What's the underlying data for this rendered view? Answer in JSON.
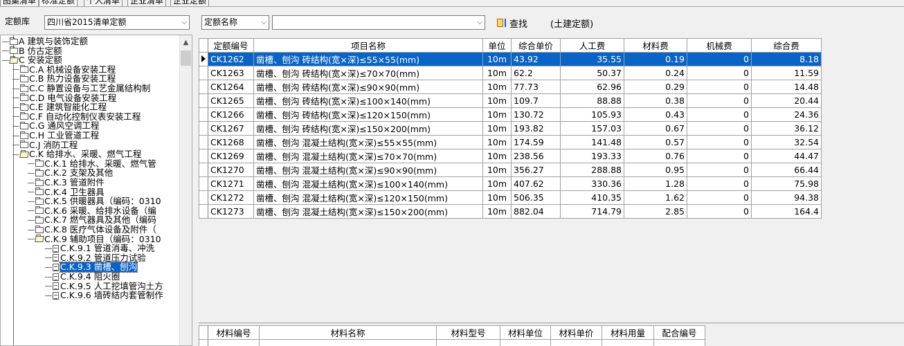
{
  "tabs": [
    "图集清单",
    "标准定额",
    "个人清单",
    "企业清单",
    "企业定额"
  ],
  "toolbar": {
    "library_label": "定额库",
    "library_value": "四川省2015清单定额",
    "field_value": "定额名称",
    "search_value": "",
    "search_label": "查找",
    "search_scope": "(土建定额)"
  },
  "tree": {
    "items": [
      {
        "label": "A 建筑与装饰定额",
        "icon": "folder-closed-icon",
        "depth": 0
      },
      {
        "label": "B 仿古定额",
        "icon": "folder-closed-icon",
        "depth": 0
      },
      {
        "label": "C 安装定额",
        "icon": "folder-open-icon",
        "depth": 0
      },
      {
        "label": "C.A 机械设备安装工程",
        "icon": "folder-closed-icon",
        "depth": 1
      },
      {
        "label": "C.B 热力设备安装工程",
        "icon": "folder-closed-icon",
        "depth": 1
      },
      {
        "label": "C.C 静置设备与工艺金属结构制",
        "icon": "folder-closed-icon",
        "depth": 1
      },
      {
        "label": "C.D 电气设备安装工程",
        "icon": "folder-closed-icon",
        "depth": 1
      },
      {
        "label": "C.E 建筑智能化工程",
        "icon": "folder-closed-icon",
        "depth": 1
      },
      {
        "label": "C.F 自动化控制仪表安装工程",
        "icon": "folder-closed-icon",
        "depth": 1
      },
      {
        "label": "C.G 通风空调工程",
        "icon": "folder-closed-icon",
        "depth": 1
      },
      {
        "label": "C.H 工业管道工程",
        "icon": "folder-closed-icon",
        "depth": 1
      },
      {
        "label": "C.J 消防工程",
        "icon": "folder-closed-icon",
        "depth": 1
      },
      {
        "label": "C.K 给排水、采暖、燃气工程",
        "icon": "folder-open-icon",
        "depth": 1
      },
      {
        "label": "C.K.1 给排水、采暖、燃气管",
        "icon": "folder-closed-icon",
        "depth": 2
      },
      {
        "label": "C.K.2 支架及其他",
        "icon": "folder-closed-icon",
        "depth": 2
      },
      {
        "label": "C.K.3 管道附件",
        "icon": "folder-closed-icon",
        "depth": 2
      },
      {
        "label": "C.K.4 卫生器具",
        "icon": "folder-closed-icon",
        "depth": 2
      },
      {
        "label": "C.K.5 供暖器具（编码：0310",
        "icon": "folder-closed-icon",
        "depth": 2
      },
      {
        "label": "C.K.6 采暖、给排水设备（编",
        "icon": "folder-closed-icon",
        "depth": 2
      },
      {
        "label": "C.K.7 燃气器具及其他（编码",
        "icon": "folder-closed-icon",
        "depth": 2
      },
      {
        "label": "C.K.8 医疗气体设备及附件（",
        "icon": "folder-closed-icon",
        "depth": 2
      },
      {
        "label": "C.K.9 辅助项目（编码：0310",
        "icon": "folder-open-icon",
        "depth": 2
      },
      {
        "label": "C.K.9.1 管道消毒、冲洗",
        "icon": "document-icon",
        "depth": 3
      },
      {
        "label": "C.K.9.2 管道压力试验",
        "icon": "document-icon",
        "depth": 3
      },
      {
        "label": "C.K.9.3 凿槽、刨沟",
        "icon": "document-icon",
        "depth": 3,
        "selected": true
      },
      {
        "label": "C.K.9.4 阻火圈",
        "icon": "document-icon",
        "depth": 3
      },
      {
        "label": "C.K.9.5 人工挖填管沟土方",
        "icon": "document-icon",
        "depth": 3
      },
      {
        "label": "C.K.9.6 墙砖结内套管制作",
        "icon": "document-icon",
        "depth": 3
      }
    ]
  },
  "grid": {
    "headers": [
      "定额编号",
      "项目名称",
      "单位",
      "综合单价",
      "人工费",
      "材料费",
      "机械费",
      "综合费"
    ],
    "rows": [
      [
        "CK1262",
        "凿槽、刨沟 砖结构(宽×深)≤55×55(mm)",
        "10m",
        "43.92",
        "35.55",
        "0.19",
        "0",
        "8.18"
      ],
      [
        "CK1263",
        "凿槽、刨沟 砖结构(宽×深)≤70×70(mm)",
        "10m",
        "62.2",
        "50.37",
        "0.24",
        "0",
        "11.59"
      ],
      [
        "CK1264",
        "凿槽、刨沟 砖结构(宽×深)≤90×90(mm)",
        "10m",
        "77.73",
        "62.96",
        "0.29",
        "0",
        "14.48"
      ],
      [
        "CK1265",
        "凿槽、刨沟 砖结构(宽×深)≤100×140(mm)",
        "10m",
        "109.7",
        "88.88",
        "0.38",
        "0",
        "20.44"
      ],
      [
        "CK1266",
        "凿槽、刨沟 砖结构(宽×深)≤120×150(mm)",
        "10m",
        "130.72",
        "105.93",
        "0.43",
        "0",
        "24.36"
      ],
      [
        "CK1267",
        "凿槽、刨沟 砖结构(宽×深)≤150×200(mm)",
        "10m",
        "193.82",
        "157.03",
        "0.67",
        "0",
        "36.12"
      ],
      [
        "CK1268",
        "凿槽、刨沟 混凝土结构(宽×深)≤55×55(mm)",
        "10m",
        "174.59",
        "141.48",
        "0.57",
        "0",
        "32.54"
      ],
      [
        "CK1269",
        "凿槽、刨沟 混凝土结构(宽×深)≤70×70(mm)",
        "10m",
        "238.56",
        "193.33",
        "0.76",
        "0",
        "44.47"
      ],
      [
        "CK1270",
        "凿槽、刨沟 混凝土结构(宽×深)≤90×90(mm)",
        "10m",
        "356.27",
        "288.88",
        "0.95",
        "0",
        "66.44"
      ],
      [
        "CK1271",
        "凿槽、刨沟 混凝土结构(宽×深)≤100×140(mm)",
        "10m",
        "407.62",
        "330.36",
        "1.28",
        "0",
        "75.98"
      ],
      [
        "CK1272",
        "凿槽、刨沟 混凝土结构(宽×深)≤120×150(mm)",
        "10m",
        "506.35",
        "410.35",
        "1.62",
        "0",
        "94.38"
      ],
      [
        "CK1273",
        "凿槽、刨沟 混凝土结构(宽×深)≤150×200(mm)",
        "10m",
        "882.04",
        "714.79",
        "2.85",
        "0",
        "164.4"
      ]
    ],
    "selected_row": 0
  },
  "material_grid": {
    "headers": [
      "材料编号",
      "材料名称",
      "材料型号",
      "材料单位",
      "材料单价",
      "材料用量",
      "配合编号"
    ]
  },
  "colors": {
    "selection": "#0a64c8",
    "grid_line": "#a0a0a0"
  }
}
